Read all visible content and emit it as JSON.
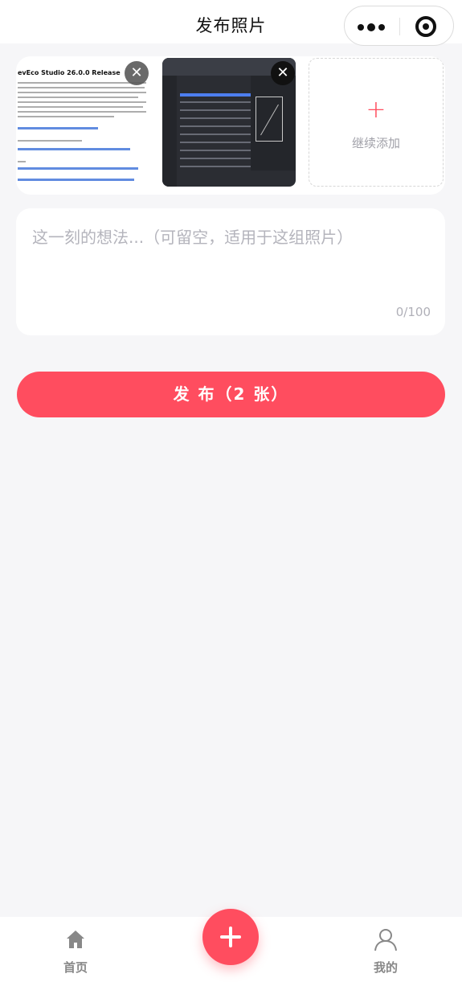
{
  "navbar": {
    "title": "发布照片",
    "more_icon": "more-dots-icon",
    "close_icon": "target-circle-icon"
  },
  "photos": {
    "items": [
      {
        "name": "photo-1",
        "doc_title": "evEco Studio 26.0.0 Release",
        "remove_icon": "close-icon"
      },
      {
        "name": "photo-2",
        "remove_icon": "close-icon"
      }
    ],
    "add_more_label": "继续添加",
    "add_icon": "plus-icon"
  },
  "caption": {
    "placeholder": "这一刻的想法...（可留空，适用于这组照片）",
    "value": "",
    "counter": "0/100"
  },
  "publish_button": {
    "label": "发 布（2 张）"
  },
  "tabbar": {
    "home_label": "首页",
    "home_icon": "home-icon",
    "mine_label": "我的",
    "mine_icon": "user-icon",
    "fab_icon": "plus-icon"
  },
  "colors": {
    "accent": "#ff4d5f",
    "background": "#f6f6f8"
  }
}
